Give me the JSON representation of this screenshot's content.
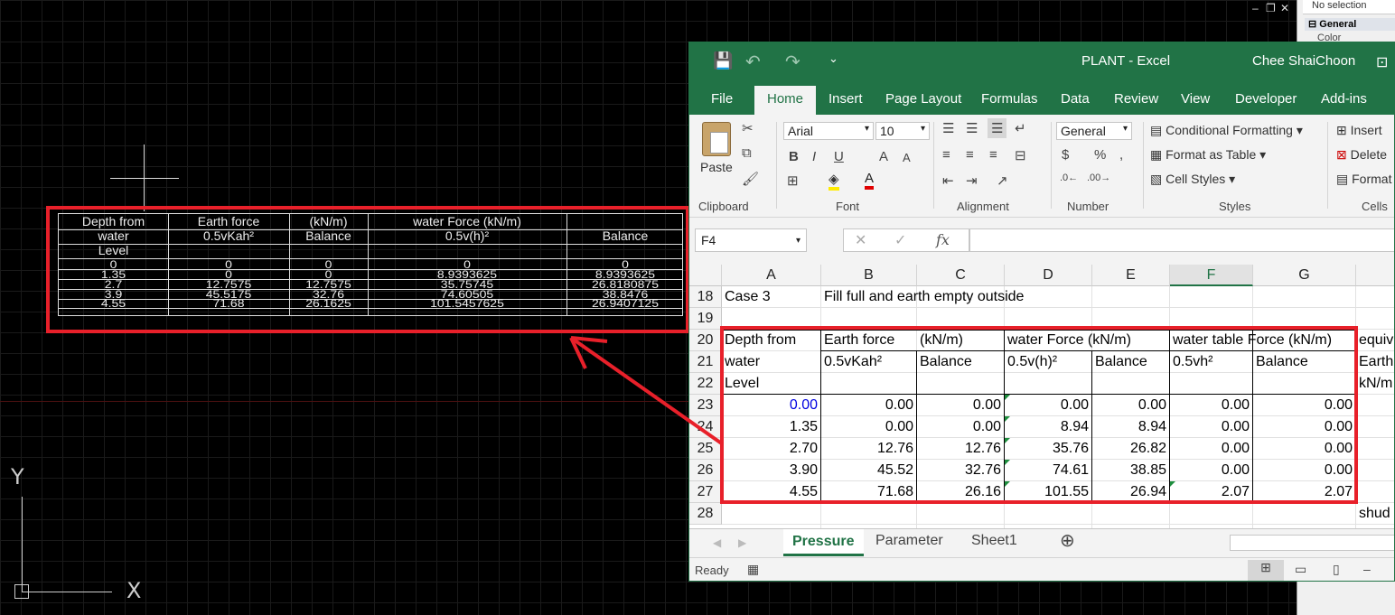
{
  "cad": {
    "table": {
      "headers": [
        [
          "Depth from",
          "water",
          "Level"
        ],
        [
          "Earth force",
          "0.5vKah²"
        ],
        [
          "(kN/m)",
          "Balance"
        ],
        [
          "water Force (kN/m)",
          "0.5v(h)²"
        ],
        [
          "Balance"
        ]
      ],
      "rows": [
        [
          "0",
          "0",
          "0",
          "0",
          "0"
        ],
        [
          "1.35",
          "0",
          "0",
          "8.9393625",
          "8.9393625"
        ],
        [
          "2.7",
          "12.7575",
          "12.7575",
          "35.75745",
          "26.8180875"
        ],
        [
          "3.9",
          "45.5175",
          "32.76",
          "74.60505",
          "38.8476"
        ],
        [
          "4.55",
          "71.68",
          "26.1625",
          "101.5457625",
          "26.9407125"
        ]
      ]
    },
    "ucs": {
      "x_label": "X",
      "y_label": "Y"
    },
    "controls": {
      "minimize": "‒",
      "restore": "❐",
      "close": "✕"
    }
  },
  "properties": {
    "selection": "No selection",
    "group": "General",
    "item": "Color"
  },
  "excel": {
    "qat": {
      "save": "💾",
      "undo": "↶",
      "redo": "↷",
      "more": "⌄"
    },
    "title": "PLANT  -  Excel",
    "user": "Chee ShaiChoon",
    "ribbon_display": "⊡",
    "tabs": [
      "File",
      "Home",
      "Insert",
      "Page Layout",
      "Formulas",
      "Data",
      "Review",
      "View",
      "Developer",
      "Add-ins"
    ],
    "active_tab": "Home",
    "ribbon": {
      "paste": "Paste",
      "font_name": "Arial",
      "font_size": "10",
      "number_format": "General",
      "conditional_formatting": "Conditional Formatting",
      "format_as_table": "Format as Table",
      "cell_styles": "Cell Styles",
      "insert": "Insert",
      "delete": "Delete",
      "format": "Format",
      "groups": [
        "Clipboard",
        "Font",
        "Alignment",
        "Number",
        "Styles",
        "Cells"
      ]
    },
    "name_box": "F4",
    "fx": "fx",
    "columns": [
      "A",
      "B",
      "C",
      "D",
      "E",
      "F",
      "G"
    ],
    "selected_column": "F",
    "row_numbers": [
      "18",
      "19",
      "20",
      "21",
      "22",
      "23",
      "24",
      "25",
      "26",
      "27",
      "28"
    ],
    "rows": {
      "r18": {
        "a": "Case 3",
        "b": "Fill full and earth empty outside"
      },
      "r20": {
        "a": "Depth from",
        "b": "Earth force",
        "c": "(kN/m)",
        "d": "water Force (kN/m)",
        "f": "water table Force (kN/m)",
        "h": "equiv"
      },
      "r21": {
        "a": "water",
        "b": "0.5vKah²",
        "c": "Balance",
        "d": "0.5v(h)²",
        "e": "Balance",
        "f": "0.5vh²",
        "g": "Balance",
        "h": "Earth"
      },
      "r22": {
        "a": "Level",
        "h": "kN/m"
      },
      "r28": {
        "h": "shud"
      }
    },
    "data": [
      [
        "0.00",
        "0.00",
        "0.00",
        "0.00",
        "0.00",
        "0.00",
        "0.00"
      ],
      [
        "1.35",
        "0.00",
        "0.00",
        "8.94",
        "8.94",
        "0.00",
        "0.00"
      ],
      [
        "2.70",
        "12.76",
        "12.76",
        "35.76",
        "26.82",
        "0.00",
        "0.00"
      ],
      [
        "3.90",
        "45.52",
        "32.76",
        "74.61",
        "38.85",
        "0.00",
        "0.00"
      ],
      [
        "4.55",
        "71.68",
        "26.16",
        "101.55",
        "26.94",
        "2.07",
        "2.07"
      ]
    ],
    "sheets": [
      "Pressure",
      "Parameter",
      "Sheet1"
    ],
    "active_sheet": "Pressure",
    "status": "Ready"
  }
}
